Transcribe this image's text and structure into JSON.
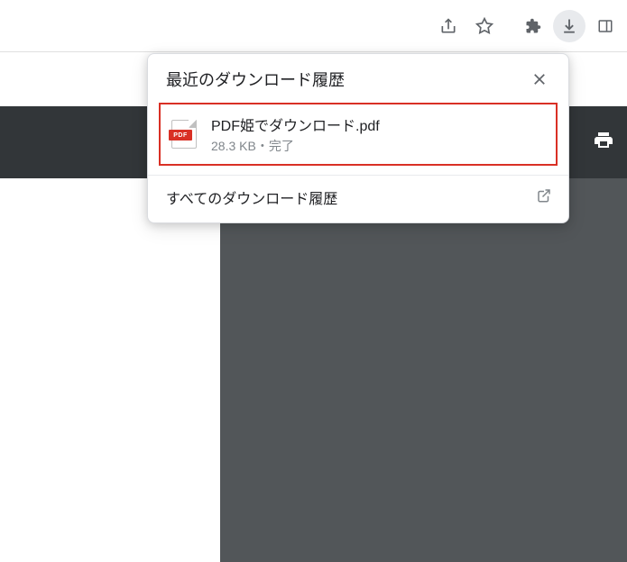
{
  "popup": {
    "title": "最近のダウンロード履歴",
    "all_downloads": "すべてのダウンロード履歴",
    "file": {
      "icon_badge": "PDF",
      "name": "PDF姫でダウンロード.pdf",
      "meta": "28.3 KB・完了"
    }
  }
}
